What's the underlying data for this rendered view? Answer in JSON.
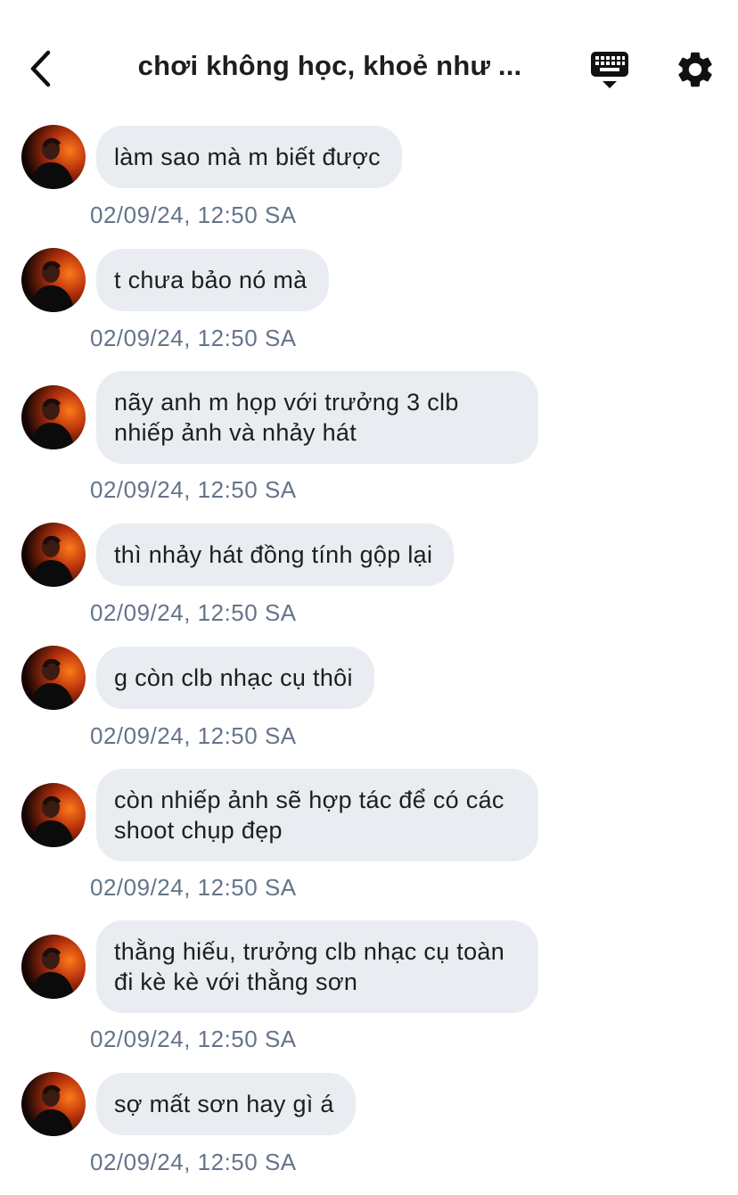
{
  "header": {
    "title": "chơi không học, khoẻ như ...",
    "back_icon": "chevron-left-icon",
    "keyboard_icon": "keyboard-icon",
    "settings_icon": "gear-icon"
  },
  "messages": [
    {
      "text": "làm sao mà m biết được",
      "time": "02/09/24, 12:50 SA"
    },
    {
      "text": "t chưa bảo nó mà",
      "time": "02/09/24, 12:50 SA"
    },
    {
      "text": "nãy anh m họp với trưởng 3 clb nhiếp ảnh và nhảy hát",
      "time": "02/09/24, 12:50 SA"
    },
    {
      "text": "thì nhảy hát đồng tính gộp lại",
      "time": "02/09/24, 12:50 SA"
    },
    {
      "text": "g còn clb nhạc cụ thôi",
      "time": "02/09/24, 12:50 SA"
    },
    {
      "text": "còn nhiếp ảnh sẽ hợp tác để có các shoot chụp đẹp",
      "time": "02/09/24, 12:50 SA"
    },
    {
      "text": "thằng hiếu, trưởng clb nhạc cụ toàn đi kè kè với thằng sơn",
      "time": "02/09/24, 12:50 SA"
    },
    {
      "text": "sợ mất sơn hay gì á",
      "time": "02/09/24, 12:50 SA"
    }
  ],
  "colors": {
    "bubble_bg": "#e9edf1",
    "timestamp": "#65748a",
    "title": "#1c1e21"
  }
}
